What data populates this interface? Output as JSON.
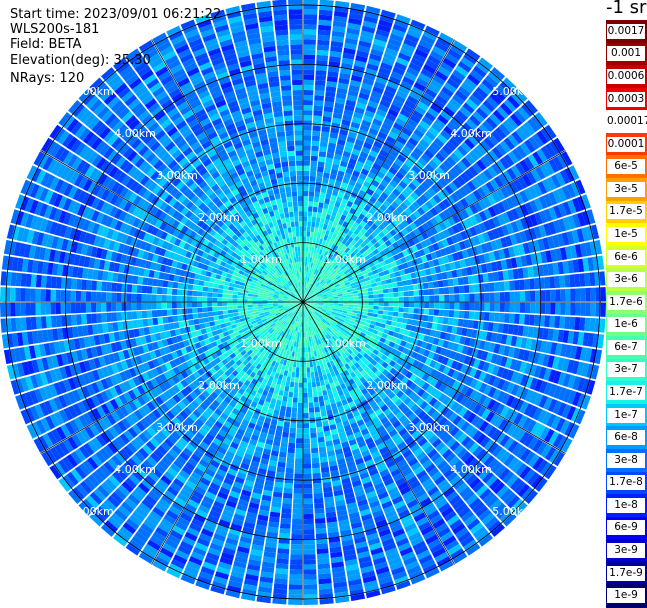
{
  "header": {
    "start_time": "Start time: 2023/09/01 06:21:22",
    "instrument": "WLS200s-181",
    "field": "Field: BETA",
    "elevation": "Elevation(deg): 35.30",
    "nrays": "NRays: 120"
  },
  "colorbar": {
    "unit_label": "-1 sr",
    "ticks": [
      "0.0017",
      "0.001",
      "0.0006",
      "0.0003",
      "0.00017",
      "0.0001",
      "6e-5",
      "3e-5",
      "1.7e-5",
      "1e-5",
      "6e-6",
      "3e-6",
      "1.7e-6",
      "1e-6",
      "6e-7",
      "3e-7",
      "1.7e-7",
      "1e-7",
      "6e-8",
      "3e-8",
      "1.7e-8",
      "1e-8",
      "6e-9",
      "3e-9",
      "1.7e-9",
      "1e-9"
    ],
    "colors": [
      "#7a0000",
      "#9c0000",
      "#c40000",
      "#ee0000",
      "#ffffff",
      "#ff3a00",
      "#ff7000",
      "#ff9e00",
      "#ffd000",
      "#ffff00",
      "#d8ff26",
      "#b8ff46",
      "#8eff6f",
      "#6cff8e",
      "#48ffb0",
      "#30ffc9",
      "#14f4ea",
      "#00c8ff",
      "#009cff",
      "#0070ff",
      "#0048ff",
      "#0020ff",
      "#0000f4",
      "#0000c8",
      "#00009c",
      "#000070"
    ]
  },
  "chart_data": {
    "type": "heatmap",
    "projection": "polar (PPI scan)",
    "field": "BETA",
    "elevation_deg": 35.3,
    "n_rays": 120,
    "range_rings_km": [
      1.0,
      2.0,
      3.0,
      4.0,
      5.0
    ],
    "ring_labels": [
      "1.00km",
      "2.00km",
      "3.00km",
      "4.00km",
      "5.00km"
    ],
    "spokes_deg": [
      0,
      30,
      60,
      90,
      120,
      150,
      180,
      210,
      240,
      270,
      300,
      330
    ],
    "max_range_km": 5.1,
    "value_profile": [
      {
        "range_km": 0.0,
        "beta": 3e-07
      },
      {
        "range_km": 1.0,
        "beta": 2e-07
      },
      {
        "range_km": 2.0,
        "beta": 6e-08
      },
      {
        "range_km": 3.0,
        "beta": 4e-08
      },
      {
        "range_km": 4.0,
        "beta": 3e-08
      },
      {
        "range_km": 5.0,
        "beta": 3e-08
      }
    ],
    "color_scale": "log",
    "vmin": 1e-09,
    "vmax": 0.0017
  }
}
